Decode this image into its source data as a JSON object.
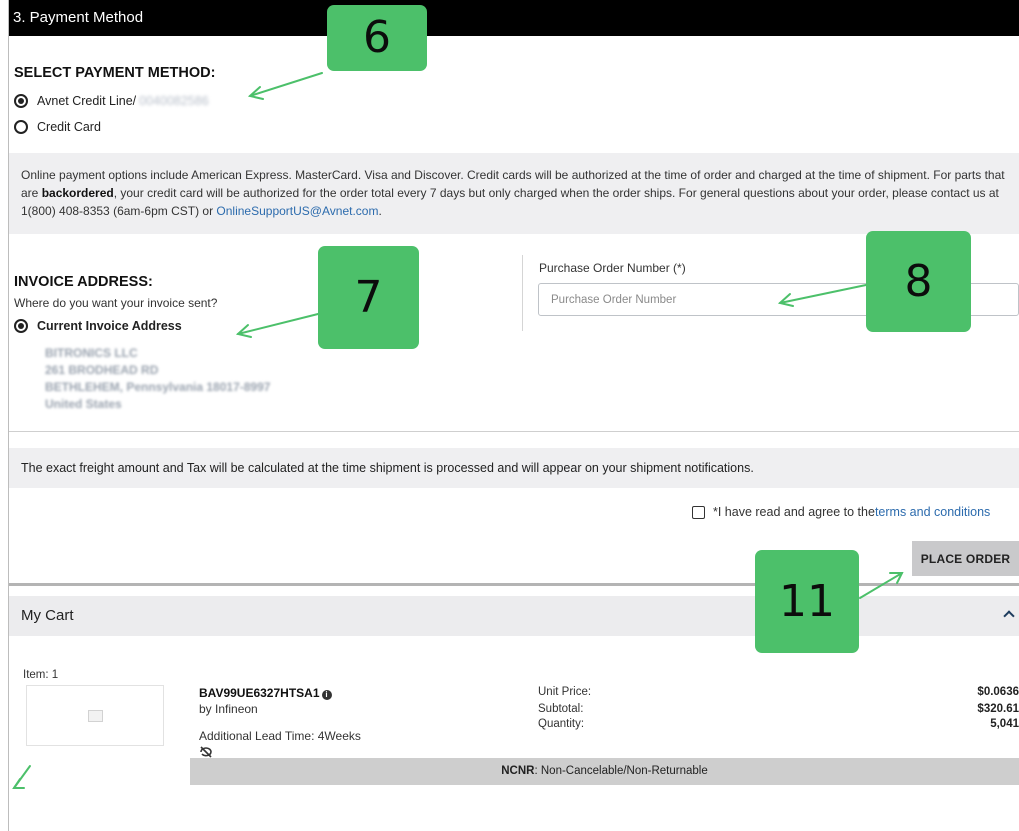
{
  "section": {
    "title": "3. Payment Method"
  },
  "payment": {
    "heading": "SELECT PAYMENT METHOD:",
    "options": [
      {
        "label": "Avnet Credit Line/",
        "account": "0040082586",
        "selected": true
      },
      {
        "label": "Credit Card",
        "selected": false
      }
    ]
  },
  "info": {
    "text_1": "Online payment options include American Express. MasterCard. Visa and Discover. Credit cards will be authorized at the time of order and charged at the time of shipment. For parts that are ",
    "bold": "backordered",
    "text_2": ", your credit card will be authorized for the order total every 7 days but only charged when the order ships. For general questions about your order, please contact us at 1(800) 408-8353 (6am-6pm CST) or ",
    "link": "OnlineSupportUS@Avnet.com",
    "text_3": "."
  },
  "invoice": {
    "heading": "INVOICE ADDRESS:",
    "question": "Where do you want your invoice sent?",
    "option_label": "Current Invoice Address",
    "address_lines": [
      "BITRONICS LLC",
      "261 BRODHEAD RD",
      "BETHLEHEM, Pennsylvania 18017-8997",
      "United States"
    ]
  },
  "po": {
    "label": "Purchase Order Number (*)",
    "placeholder": "Purchase Order Number",
    "value": ""
  },
  "freight": {
    "text": "The exact freight amount and Tax will be calculated at the time shipment is processed and will appear on your shipment notifications."
  },
  "terms": {
    "prefix": "*I have read and agree to the ",
    "link": "terms and conditions",
    "checked": false
  },
  "place_order": {
    "label": "PLACE ORDER"
  },
  "cart": {
    "title": "My Cart",
    "item_label": "Item: 1",
    "part_number": "BAV99UE6327HTSA1",
    "manufacturer": "by Infineon",
    "lead_time": "Additional Lead Time: 4Weeks",
    "unit_price_label": "Unit Price:",
    "unit_price": "$0.0636",
    "subtotal_label": "Subtotal:",
    "subtotal": "$320.61",
    "quantity_label": "Quantity:",
    "quantity": "5,041",
    "ncnr_bold": "NCNR",
    "ncnr_text": ": Non-Cancelable/Non-Returnable"
  },
  "callouts": [
    "6",
    "7",
    "8",
    "11"
  ],
  "colors": {
    "header": "#000000",
    "callout": "#4cc06a",
    "arrow": "#4cc06a",
    "link": "#2c6bad",
    "panel": "#efeff1"
  }
}
